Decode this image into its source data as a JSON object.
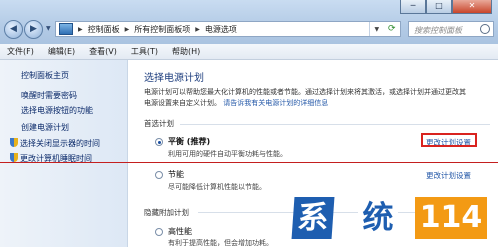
{
  "window": {
    "controls": {
      "minimize": "─",
      "maximize": "□",
      "close": "✕"
    },
    "breadcrumbs": [
      "控制面板",
      "所有控制面板项",
      "电源选项"
    ],
    "search_placeholder": "搜索控制面板"
  },
  "menu": [
    "文件(F)",
    "编辑(E)",
    "查看(V)",
    "工具(T)",
    "帮助(H)"
  ],
  "sidebar": {
    "home": "控制面板主页",
    "links": [
      "唤醒时需要密码",
      "选择电源按钮的功能",
      "创建电源计划",
      "选择关闭显示器的时间",
      "更改计算机睡眠时间"
    ]
  },
  "main": {
    "title": "选择电源计划",
    "description_1": "电源计划可以帮助您最大化计算机的性能或者节能。通过选择计划来将其激活，或选择计划并通过更改其",
    "description_2": "电源设置来自定义计划。",
    "description_link": "请告诉我有关电源计划的详细信息",
    "preferred_label": "首选计划",
    "plans": [
      {
        "name": "平衡 (推荐)",
        "desc": "利用可用的硬件自动平衡功耗与性能。",
        "change": "更改计划设置",
        "selected": true
      },
      {
        "name": "节能",
        "desc": "尽可能降低计算机性能以节能。",
        "change": "更改计划设置",
        "selected": false
      }
    ],
    "hidden_label": "隐藏附加计划",
    "extra_plan": {
      "name": "高性能",
      "desc": "有利于提高性能，但会增加功耗。"
    }
  },
  "watermark": {
    "chars": [
      "系",
      "统",
      "114"
    ]
  },
  "colors": {
    "accent": "#1e5eb0",
    "highlight": "#d9231f",
    "watermark_orange": "#f39a14"
  }
}
